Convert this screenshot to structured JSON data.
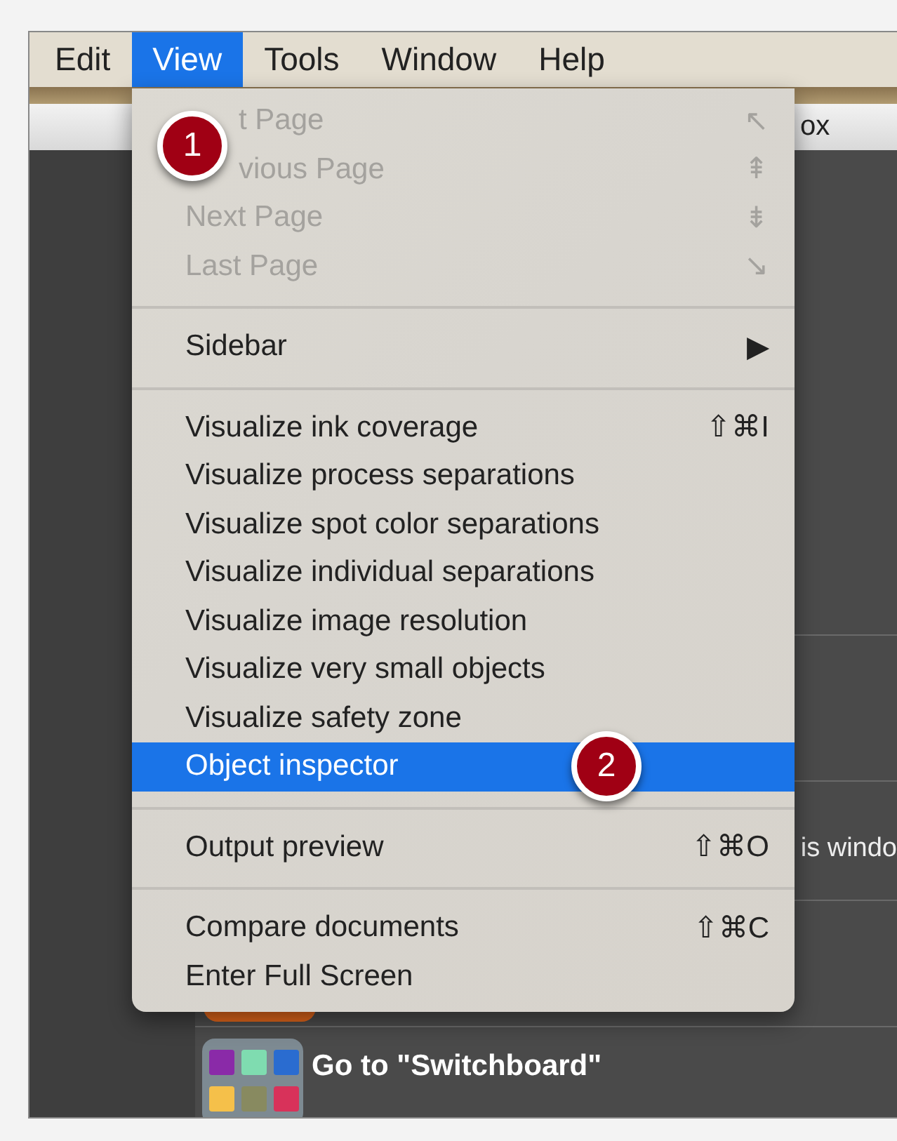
{
  "menubar": [
    {
      "label": "Edit",
      "selected": false
    },
    {
      "label": "View",
      "selected": true
    },
    {
      "label": "Tools",
      "selected": false
    },
    {
      "label": "Window",
      "selected": false
    },
    {
      "label": "Help",
      "selected": false
    }
  ],
  "title_bar": {
    "title": "ox"
  },
  "background_rows": [
    {
      "text": "is windo"
    },
    {
      "title": "Go to \"Switchboard\""
    }
  ],
  "menu": {
    "groups": [
      [
        {
          "label": "t Page",
          "shortcut": "↖",
          "disabled": true,
          "under_badge": true
        },
        {
          "label": "vious Page",
          "shortcut": "⇞",
          "disabled": true,
          "under_badge": true
        },
        {
          "label": "Next Page",
          "shortcut": "⇟",
          "disabled": true,
          "under_badge": false
        },
        {
          "label": "Last Page",
          "shortcut": "↘",
          "disabled": true,
          "under_badge": false
        }
      ],
      [
        {
          "label": "Sidebar",
          "shortcut": "▶",
          "disabled": false,
          "under_badge": false
        }
      ],
      [
        {
          "label": "Visualize ink coverage",
          "shortcut": "⇧⌘I",
          "disabled": false,
          "under_badge": false
        },
        {
          "label": "Visualize process separations",
          "disabled": false,
          "under_badge": false
        },
        {
          "label": "Visualize spot color separations",
          "disabled": false,
          "under_badge": false
        },
        {
          "label": "Visualize individual separations",
          "disabled": false,
          "under_badge": false
        },
        {
          "label": "Visualize image resolution",
          "disabled": false,
          "under_badge": false
        },
        {
          "label": "Visualize very small objects",
          "disabled": false,
          "under_badge": false
        },
        {
          "label": "Visualize safety zone",
          "disabled": false,
          "under_badge": false
        },
        {
          "label": "Object inspector",
          "disabled": false,
          "under_badge": false,
          "selected": true
        }
      ],
      [
        {
          "label": "Output preview",
          "shortcut": "⇧⌘O",
          "disabled": false,
          "under_badge": false
        }
      ],
      [
        {
          "label": "Compare documents",
          "shortcut": "⇧⌘C",
          "disabled": false,
          "under_badge": false
        },
        {
          "label": "Enter Full Screen",
          "disabled": false,
          "under_badge": false
        }
      ]
    ]
  },
  "badges": [
    {
      "number": "1"
    },
    {
      "number": "2"
    }
  ]
}
